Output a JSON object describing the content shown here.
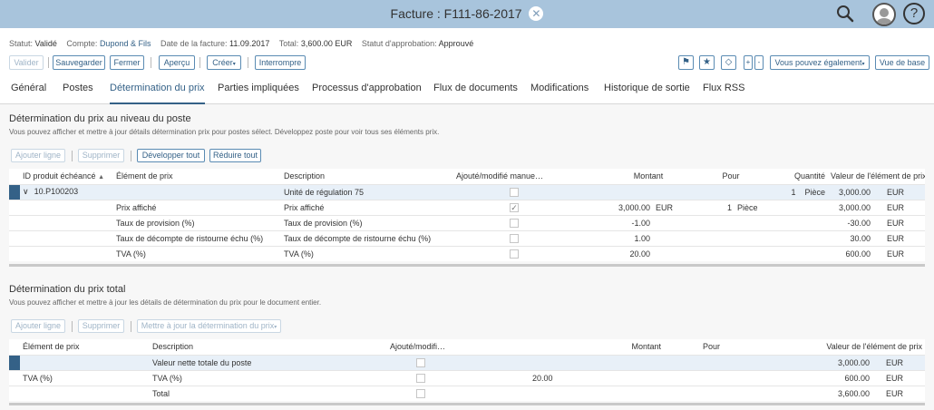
{
  "shell": {
    "title": "Facture : F111-86-2017",
    "close_glyph": "✕",
    "help_glyph": "?"
  },
  "status": {
    "statut_label": "Statut:",
    "statut_value": "Validé",
    "compte_label": "Compte:",
    "compte_value": "Dupond & Fils",
    "date_label": "Date de la facture:",
    "date_value": "11.09.2017",
    "total_label": "Total:",
    "total_value": "3,600.00 EUR",
    "approb_label": "Statut d'approbation:",
    "approb_value": "Approuvé"
  },
  "toolbar": {
    "valider": "Valider",
    "sauvegarder": "Sauvegarder",
    "fermer": "Fermer",
    "apercu": "Aperçu",
    "creer": "Créer",
    "interrompre": "Interrompre",
    "vous_pouvez": "Vous pouvez également",
    "vue_de_base": "Vue de base",
    "flag_glyph": "⚑",
    "star_glyph": "★",
    "tag_glyph": "◇"
  },
  "tabs": [
    {
      "label": "Général"
    },
    {
      "label": "Postes"
    },
    {
      "label": "Détermination du prix"
    },
    {
      "label": "Parties impliquées"
    },
    {
      "label": "Processus d'approbation"
    },
    {
      "label": "Flux de documents"
    },
    {
      "label": "Modifications"
    },
    {
      "label": "Historique de sortie"
    },
    {
      "label": "Flux RSS"
    }
  ],
  "section1": {
    "title": "Détermination du prix au niveau du poste",
    "subtitle": "Vous pouvez afficher et mettre à jour détails détermination prix pour postes sélect. Développez poste pour voir tous ses éléments prix.",
    "buttons": {
      "ajouter": "Ajouter ligne",
      "supprimer": "Supprimer",
      "developper": "Développer tout",
      "reduire": "Réduire tout"
    },
    "columns": {
      "id": "ID produit échéancé",
      "element": "Élément de prix",
      "description": "Description",
      "ajoute": "Ajouté/modifié manue…",
      "montant": "Montant",
      "pour": "Pour",
      "quantite": "Quantité",
      "valeur": "Valeur de l'élément de prix"
    },
    "sort_glyph": "▲",
    "expand_glyph": "∨",
    "rows": [
      {
        "id": "10.P100203",
        "element": "",
        "description": "Unité de régulation 75",
        "checked": "",
        "montant": "",
        "devise": "",
        "pour": "",
        "pour_unit": "",
        "qty": "1",
        "qty_unit": "Pièce",
        "valeur": "3,000.00",
        "valeur_cur": "EUR"
      },
      {
        "id": "",
        "element": "Prix affiché",
        "description": "Prix affiché",
        "checked": "✓",
        "montant": "3,000.00",
        "devise": "EUR",
        "pour": "1",
        "pour_unit": "Pièce",
        "qty": "",
        "qty_unit": "",
        "valeur": "3,000.00",
        "valeur_cur": "EUR"
      },
      {
        "id": "",
        "element": "Taux de provision (%)",
        "description": "Taux de provision (%)",
        "checked": "",
        "montant": "-1.00",
        "devise": "",
        "pour": "",
        "pour_unit": "",
        "qty": "",
        "qty_unit": "",
        "valeur": "-30.00",
        "valeur_cur": "EUR"
      },
      {
        "id": "",
        "element": "Taux de décompte de ristourne échu (%)",
        "description": "Taux de décompte de ristourne échu (%)",
        "checked": "",
        "montant": "1.00",
        "devise": "",
        "pour": "",
        "pour_unit": "",
        "qty": "",
        "qty_unit": "",
        "valeur": "30.00",
        "valeur_cur": "EUR"
      },
      {
        "id": "",
        "element": "TVA (%)",
        "description": "TVA (%)",
        "checked": "",
        "montant": "20.00",
        "devise": "",
        "pour": "",
        "pour_unit": "",
        "qty": "",
        "qty_unit": "",
        "valeur": "600.00",
        "valeur_cur": "EUR"
      }
    ]
  },
  "section2": {
    "title": "Détermination du prix total",
    "subtitle": "Vous pouvez afficher et mettre à jour les détails de détermination du prix pour le document entier.",
    "buttons": {
      "ajouter": "Ajouter ligne",
      "supprimer": "Supprimer",
      "mettre": "Mettre à jour la détermination du prix"
    },
    "columns": {
      "element": "Élément de prix",
      "description": "Description",
      "ajoute": "Ajouté/modifi…",
      "montant": "Montant",
      "pour": "Pour",
      "valeur": "Valeur de l'élément de prix"
    },
    "rows": [
      {
        "element": "",
        "description": "Valeur nette totale du poste",
        "montant": "",
        "valeur": "3,000.00",
        "valeur_cur": "EUR"
      },
      {
        "element": "TVA (%)",
        "description": "TVA (%)",
        "montant": "20.00",
        "valeur": "600.00",
        "valeur_cur": "EUR"
      },
      {
        "element": "",
        "description": "Total",
        "montant": "",
        "valeur": "3,600.00",
        "valeur_cur": "EUR"
      }
    ]
  }
}
